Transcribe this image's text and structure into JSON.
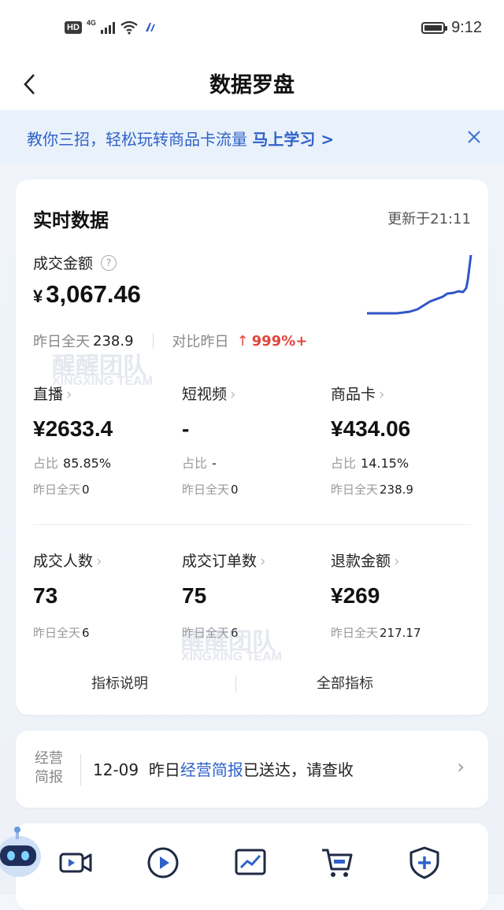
{
  "status_bar": {
    "hd": "HD",
    "network": "4G",
    "time": "9:12"
  },
  "nav": {
    "back_icon": "chevron-left-icon",
    "title": "数据罗盘"
  },
  "banner": {
    "text": "教你三招，轻松玩转商品卡流量 ",
    "cta": "马上学习 >",
    "close_icon": "close-icon"
  },
  "realtime": {
    "title": "实时数据",
    "updated": "更新于21:11",
    "gmv": {
      "label": "成交金额",
      "currency": "¥",
      "value": "3,067.46",
      "help_icon": "question-circle-icon"
    },
    "yesterday_label": "昨日全天",
    "yesterday_value": "238.9",
    "compare_label": "对比昨日",
    "compare_arrow": "↑",
    "compare_value": "999%+",
    "sparkline_color": "#2f55c7",
    "channels": [
      {
        "label": "直播",
        "chev": "›",
        "value": "¥2633.4",
        "share_label": "占比",
        "share": "85.85%",
        "yday_label": "昨日全天",
        "yday": "0"
      },
      {
        "label": "短视频",
        "chev": "›",
        "value": "-",
        "share_label": "占比",
        "share": "-",
        "yday_label": "昨日全天",
        "yday": "0"
      },
      {
        "label": "商品卡",
        "chev": "›",
        "value": "¥434.06",
        "share_label": "占比",
        "share": "14.15%",
        "yday_label": "昨日全天",
        "yday": "238.9"
      }
    ],
    "metrics": [
      {
        "label": "成交人数",
        "chev": "›",
        "value": "73",
        "yday_label": "昨日全天",
        "yday": "6"
      },
      {
        "label": "成交订单数",
        "chev": "›",
        "value": "75",
        "yday_label": "昨日全天",
        "yday": "6"
      },
      {
        "label": "退款金额",
        "chev": "›",
        "value": "¥269",
        "yday_label": "昨日全天",
        "yday": "217.17"
      }
    ],
    "footer": {
      "left": "指标说明",
      "right": "全部指标"
    }
  },
  "report": {
    "tag_line1": "经营",
    "tag_line2": "简报",
    "date": "12-09",
    "pre": "昨日",
    "link": "经营简报",
    "post": "已送达，请查收",
    "chev": "›"
  },
  "tools": [
    "video-camera-icon",
    "play-circle-icon",
    "chart-icon",
    "cart-icon",
    "shield-plus-icon"
  ],
  "watermark": {
    "cn": "醒醒团队",
    "en": "XINGXING TEAM"
  },
  "colors": {
    "accent": "#2f62c9",
    "up": "#e0463c"
  }
}
